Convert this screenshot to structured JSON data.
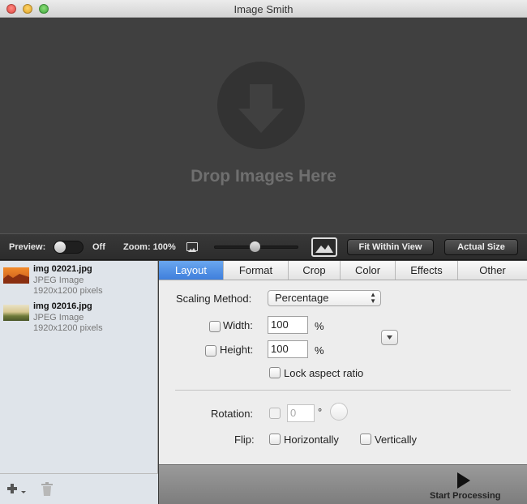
{
  "window": {
    "title": "Image Smith"
  },
  "drop_area": {
    "text": "Drop Images Here",
    "icon": "down-arrow-icon"
  },
  "preview_bar": {
    "preview_label": "Preview:",
    "preview_state": "Off",
    "zoom_label": "Zoom: 100%",
    "zoom_level": 0.5,
    "fit_button": "Fit Within View",
    "actual_size_button": "Actual Size"
  },
  "files": [
    {
      "name": "img 02021.jpg",
      "type": "JPEG Image",
      "dimensions": "1920x1200 pixels"
    },
    {
      "name": "img 02016.jpg",
      "type": "JPEG Image",
      "dimensions": "1920x1200 pixels"
    }
  ],
  "tabs": [
    {
      "label": "Layout",
      "active": true
    },
    {
      "label": "Format",
      "active": false
    },
    {
      "label": "Crop",
      "active": false
    },
    {
      "label": "Color",
      "active": false
    },
    {
      "label": "Effects",
      "active": false
    },
    {
      "label": "Other",
      "active": false
    }
  ],
  "layout": {
    "scaling_method_label": "Scaling Method:",
    "scaling_method_value": "Percentage",
    "width_label": "Width:",
    "width_value": "100",
    "width_unit": "%",
    "height_label": "Height:",
    "height_value": "100",
    "height_unit": "%",
    "lock_aspect_label": "Lock aspect ratio",
    "rotation_label": "Rotation:",
    "rotation_value": "0",
    "rotation_unit": "°",
    "flip_label": "Flip:",
    "flip_horizontal_label": "Horizontally",
    "flip_vertical_label": "Vertically"
  },
  "process": {
    "start_label": "Start Processing"
  },
  "colors": {
    "tab_active": "#3f7fdc",
    "drop_bg": "#404040",
    "sidebar_bg": "#dfe4ea"
  }
}
